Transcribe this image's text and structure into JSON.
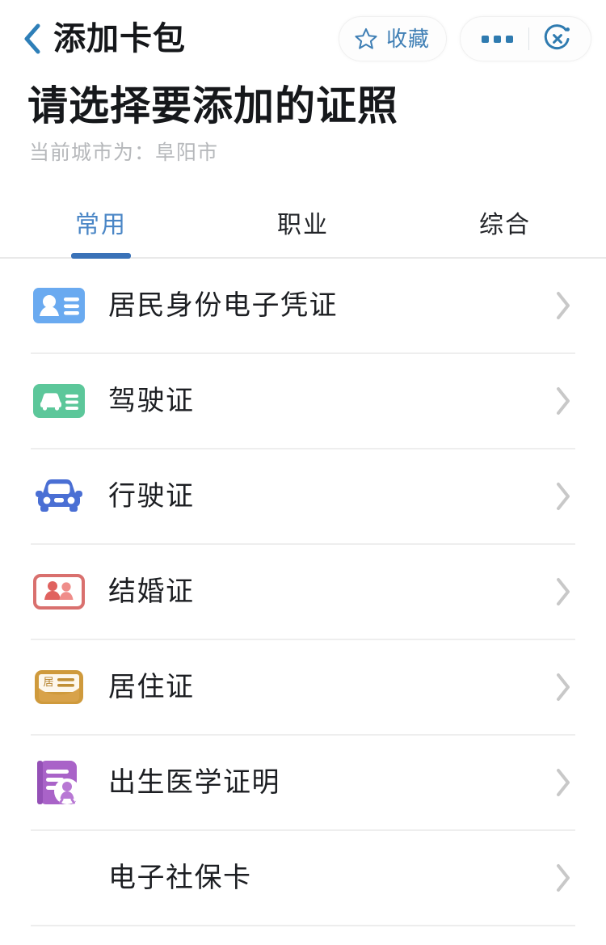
{
  "header": {
    "back_icon": "chevron-left-icon",
    "title": "添加卡包",
    "favorite": {
      "icon": "star-icon",
      "label": "收藏"
    },
    "more_icon": "more-dots-icon",
    "close_icon": "close-circle-icon",
    "accent_color": "#3f7fb5"
  },
  "page": {
    "title": "请选择要添加的证照",
    "subtitle": "当前城市为：阜阳市"
  },
  "tabs": {
    "active_index": 0,
    "active_color": "#4a86c6",
    "underline_color": "#3a72b8",
    "items": [
      {
        "label": "常用"
      },
      {
        "label": "职业"
      },
      {
        "label": "综合"
      }
    ]
  },
  "list": {
    "chevron_icon": "chevron-right-icon",
    "items": [
      {
        "label": "居民身份电子凭证",
        "icon": "id-card-icon",
        "icon_color": "#6aaaf0"
      },
      {
        "label": "驾驶证",
        "icon": "driver-license-icon",
        "icon_color": "#5cc79a"
      },
      {
        "label": "行驶证",
        "icon": "vehicle-license-car-icon",
        "icon_color": "#4a6fd4"
      },
      {
        "label": "结婚证",
        "icon": "marriage-certificate-icon",
        "icon_color": "#e0625f"
      },
      {
        "label": "居住证",
        "icon": "residence-permit-icon",
        "icon_color": "#cf9a3c"
      },
      {
        "label": "出生医学证明",
        "icon": "birth-certificate-icon",
        "icon_color": "#a963c8"
      },
      {
        "label": "电子社保卡",
        "icon": "",
        "icon_color": ""
      }
    ]
  }
}
